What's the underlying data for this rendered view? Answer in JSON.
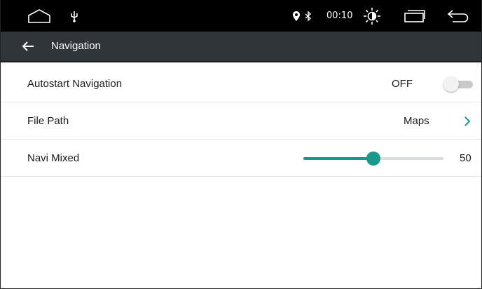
{
  "statusbar": {
    "time": "00:10",
    "icons": [
      "home-icon",
      "usb-icon",
      "location-pin-icon",
      "bluetooth-icon",
      "brightness-icon",
      "recent-apps-icon",
      "back-arrow-icon"
    ]
  },
  "titlebar": {
    "title": "Navigation",
    "back_icon": "arrow-left-icon"
  },
  "settings": {
    "autostart": {
      "label": "Autostart Navigation",
      "value": "OFF",
      "enabled": false
    },
    "file_path": {
      "label": "File Path",
      "value": "Maps"
    },
    "navi_mixed": {
      "label": "Navi Mixed",
      "value": "50",
      "level": 0.5
    }
  },
  "colors": {
    "accent": "#169a8c",
    "titlebar": "#2f3539",
    "statusbar": "#000000"
  }
}
